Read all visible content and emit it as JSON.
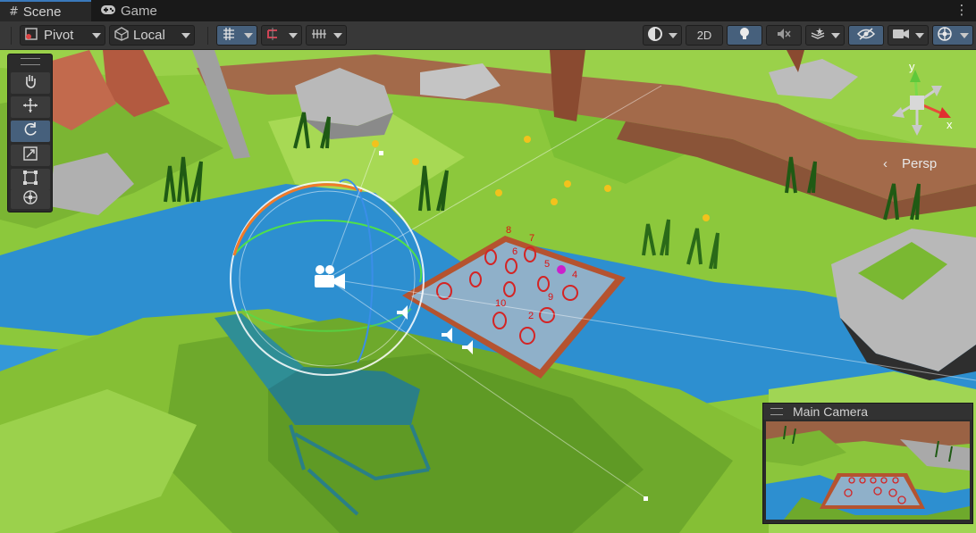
{
  "tabs": [
    {
      "label": "Scene",
      "icon": "hash-icon",
      "active": true
    },
    {
      "label": "Game",
      "icon": "gamepad-icon",
      "active": false
    }
  ],
  "toolbar": {
    "pivot_label": "Pivot",
    "local_label": "Local",
    "twod_label": "2D"
  },
  "tools": [
    {
      "name": "hand-tool",
      "icon": "hand-icon"
    },
    {
      "name": "move-tool",
      "icon": "move-icon"
    },
    {
      "name": "rotate-tool",
      "icon": "rotate-icon",
      "active": true
    },
    {
      "name": "scale-tool",
      "icon": "scale-icon"
    },
    {
      "name": "rect-tool",
      "icon": "rect-icon"
    },
    {
      "name": "transform-tool",
      "icon": "transform-icon"
    }
  ],
  "gizmo": {
    "y_label": "y",
    "x_label": "x",
    "projection_label": "Persp"
  },
  "camera_preview": {
    "title": "Main Camera"
  },
  "board_labels": [
    "8",
    "7",
    "6",
    "5",
    "4",
    "9",
    "10",
    "2"
  ],
  "colors": {
    "accent": "#46607c",
    "toolbar": "#383838",
    "tab_active": "#282828",
    "grass": "#86c23a",
    "water": "#2d8fd0",
    "board_edge": "#b5532f",
    "board_surface": "#8fb0c9"
  }
}
